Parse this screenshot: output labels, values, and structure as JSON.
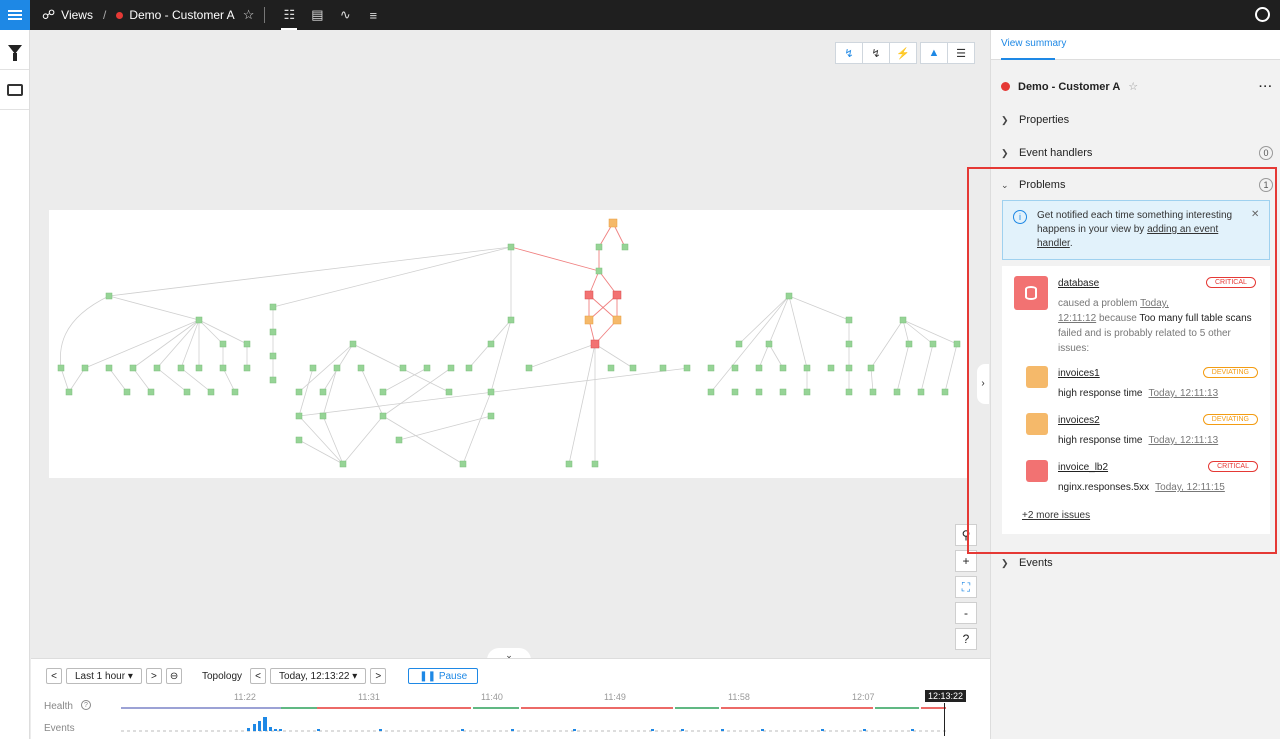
{
  "topbar": {
    "views_label": "Views",
    "view_name": "Demo - Customer A"
  },
  "colors": {
    "accent": "#1e88e5",
    "critical": "#e53935",
    "deviating": "#f39c12",
    "healthy": "#2ca05a"
  },
  "right_panel": {
    "tab": "View summary",
    "view_name": "Demo - Customer A",
    "sections": {
      "properties": "Properties",
      "event_handlers": "Event handlers",
      "event_handlers_count": "0",
      "problems": "Problems",
      "problems_count": "1",
      "events": "Events"
    },
    "info": {
      "text_prefix": "Get notified each time something interesting happens in your view by ",
      "link": "adding an event handler",
      "text_suffix": "."
    },
    "problem": {
      "name": "database",
      "severity": "CRITICAL",
      "caused_prefix": "caused a problem ",
      "caused_day": "Today,",
      "caused_time": "12:11:12",
      "because": " because ",
      "reason": "Too many full table scans",
      "tail": " failed and is probably related to 5 other issues:"
    },
    "related": [
      {
        "name": "invoices1",
        "severity": "DEVIATING",
        "detail": "high response time",
        "time": "Today, 12:11:13"
      },
      {
        "name": "invoices2",
        "severity": "DEVIATING",
        "detail": "high response time",
        "time": "Today, 12:11:13"
      },
      {
        "name": "invoice_lb2",
        "severity": "CRITICAL",
        "detail": "nginx.responses.5xx",
        "time": "Today, 12:11:15"
      }
    ],
    "more_issues": "+2 more issues"
  },
  "timeline": {
    "range": "Last 1 hour",
    "topology_label": "Topology",
    "topology_time": "Today, 12:13:22",
    "pause_label": "Pause",
    "health_label": "Health",
    "events_label": "Events",
    "ticks": [
      "11:22",
      "11:31",
      "11:40",
      "11:49",
      "11:58",
      "12:07"
    ],
    "cursor_time": "12:13:22"
  }
}
